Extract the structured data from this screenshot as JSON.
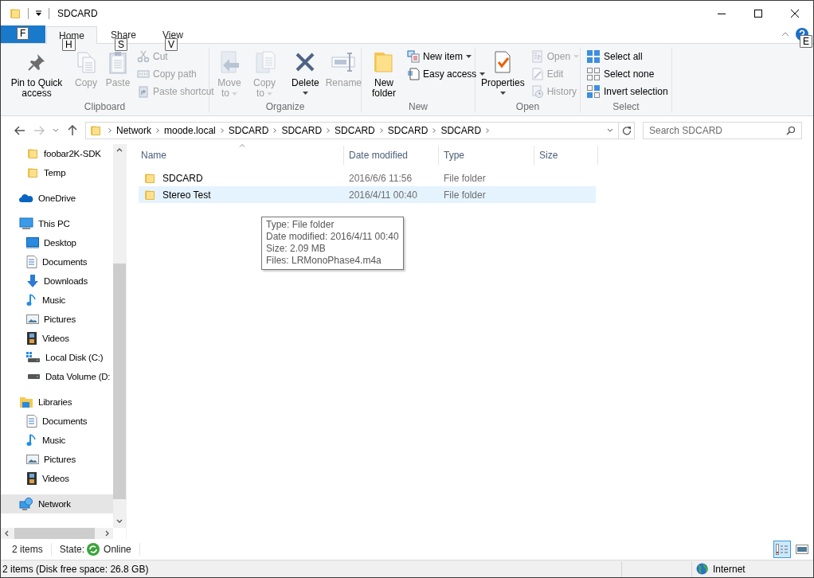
{
  "window": {
    "title": "SDCARD"
  },
  "ribbon_tabs": [
    {
      "kind": "file",
      "key_tip": "F",
      "selected": false
    },
    {
      "kind": "tab",
      "label": "Home",
      "key_tip": "H",
      "selected": true
    },
    {
      "kind": "tab",
      "label": "Share",
      "key_tip": "S",
      "selected": false
    },
    {
      "kind": "tab",
      "label": "View",
      "key_tip": "V",
      "selected": false
    }
  ],
  "help_key_tip": "E",
  "ribbon_groups": [
    {
      "label": "Clipboard",
      "commands": [
        {
          "kind": "large",
          "label": "Pin to Quick access",
          "disabled": false,
          "dropdown": false
        },
        {
          "kind": "large",
          "label": "Copy",
          "disabled": true,
          "dropdown": false
        },
        {
          "kind": "large",
          "label": "Paste",
          "disabled": true,
          "dropdown": false
        },
        {
          "kind": "small",
          "label": "Cut",
          "disabled": true,
          "dropdown": false
        },
        {
          "kind": "small",
          "label": "Copy path",
          "disabled": true,
          "dropdown": false
        },
        {
          "kind": "small",
          "label": "Paste shortcut",
          "disabled": true,
          "dropdown": false
        }
      ]
    },
    {
      "label": "Organize",
      "commands": [
        {
          "kind": "large",
          "label": "Move to",
          "disabled": true,
          "dropdown": true
        },
        {
          "kind": "large",
          "label": "Copy to",
          "disabled": true,
          "dropdown": true
        },
        {
          "kind": "large",
          "label": "Delete",
          "disabled": false,
          "dropdown": true
        },
        {
          "kind": "large",
          "label": "Rename",
          "disabled": true,
          "dropdown": false
        }
      ]
    },
    {
      "label": "New",
      "commands": [
        {
          "kind": "large",
          "label": "New folder",
          "disabled": false,
          "dropdown": false
        },
        {
          "kind": "small",
          "label": "New item",
          "disabled": false,
          "dropdown": true
        },
        {
          "kind": "small",
          "label": "Easy access",
          "disabled": false,
          "dropdown": true
        }
      ]
    },
    {
      "label": "Open",
      "commands": [
        {
          "kind": "large",
          "label": "Properties",
          "disabled": false,
          "dropdown": true
        },
        {
          "kind": "small",
          "label": "Open",
          "disabled": true,
          "dropdown": true
        },
        {
          "kind": "small",
          "label": "Edit",
          "disabled": true,
          "dropdown": false
        },
        {
          "kind": "small",
          "label": "History",
          "disabled": true,
          "dropdown": false
        }
      ]
    },
    {
      "label": "Select",
      "commands": [
        {
          "kind": "small",
          "label": "Select all",
          "disabled": false,
          "dropdown": false
        },
        {
          "kind": "small",
          "label": "Select none",
          "disabled": false,
          "dropdown": false
        },
        {
          "kind": "small",
          "label": "Invert selection",
          "disabled": false,
          "dropdown": false
        }
      ]
    }
  ],
  "navigation": {
    "back_disabled": false,
    "forward_disabled": true,
    "breadcrumbs": [
      "Network",
      "moode.local",
      "SDCARD",
      "SDCARD",
      "SDCARD",
      "SDCARD",
      "SDCARD"
    ],
    "search": {
      "placeholder": "Search SDCARD"
    }
  },
  "sidebar": {
    "items": [
      {
        "children": [
          {
            "kind": "folder",
            "label": "foobar2K-SDK",
            "selected": false
          },
          {
            "kind": "folder",
            "label": "Temp",
            "selected": false
          }
        ]
      },
      {
        "kind": "cloud",
        "label": "OneDrive",
        "selected": false
      },
      {
        "kind": "computer",
        "label": "This PC",
        "selected": false,
        "children": [
          {
            "kind": "desktop",
            "label": "Desktop",
            "selected": false
          },
          {
            "kind": "documents",
            "label": "Documents",
            "selected": false
          },
          {
            "kind": "downloads",
            "label": "Downloads",
            "selected": false
          },
          {
            "kind": "music",
            "label": "Music",
            "selected": false
          },
          {
            "kind": "pictures",
            "label": "Pictures",
            "selected": false
          },
          {
            "kind": "videos",
            "label": "Videos",
            "selected": false
          },
          {
            "kind": "system-drive",
            "label": "Local Disk (C:)",
            "selected": false
          },
          {
            "kind": "drive",
            "label": "Data Volume (D:",
            "selected": false
          }
        ]
      },
      {
        "kind": "libraries",
        "label": "Libraries",
        "selected": false,
        "children": [
          {
            "kind": "documents",
            "label": "Documents",
            "selected": false
          },
          {
            "kind": "music",
            "label": "Music",
            "selected": false
          },
          {
            "kind": "pictures",
            "label": "Pictures",
            "selected": false
          },
          {
            "kind": "videos",
            "label": "Videos",
            "selected": false
          }
        ]
      },
      {
        "kind": "network",
        "label": "Network",
        "selected": true
      }
    ]
  },
  "file_list": {
    "columns": [
      {
        "label": "Name",
        "sorted": true
      },
      {
        "label": "Date modified",
        "sorted": false
      },
      {
        "label": "Type",
        "sorted": false
      },
      {
        "label": "Size",
        "sorted": false
      }
    ],
    "rows": [
      {
        "name": "SDCARD",
        "date_modified": "2016/6/6 11:56",
        "type": "File folder",
        "highlighted": false
      },
      {
        "name": "Stereo Test",
        "date_modified": "2016/4/11 00:40",
        "type": "File folder",
        "highlighted": true
      }
    ],
    "tooltip": [
      "Type: File folder",
      "Date modified: 2016/4/11 00:40",
      "Size: 2.09 MB",
      "Files: LRMonoPhase4.m4a"
    ]
  },
  "status_bar": {
    "item_count": "2 items",
    "state_label": "State:",
    "state": "Online",
    "views": [
      {
        "kind": "details",
        "selected": true
      },
      {
        "kind": "large-icons",
        "selected": false
      }
    ]
  },
  "bottom_bar": {
    "summary": "2 items (Disk free space: 26.8 GB)",
    "zone": "Internet"
  }
}
